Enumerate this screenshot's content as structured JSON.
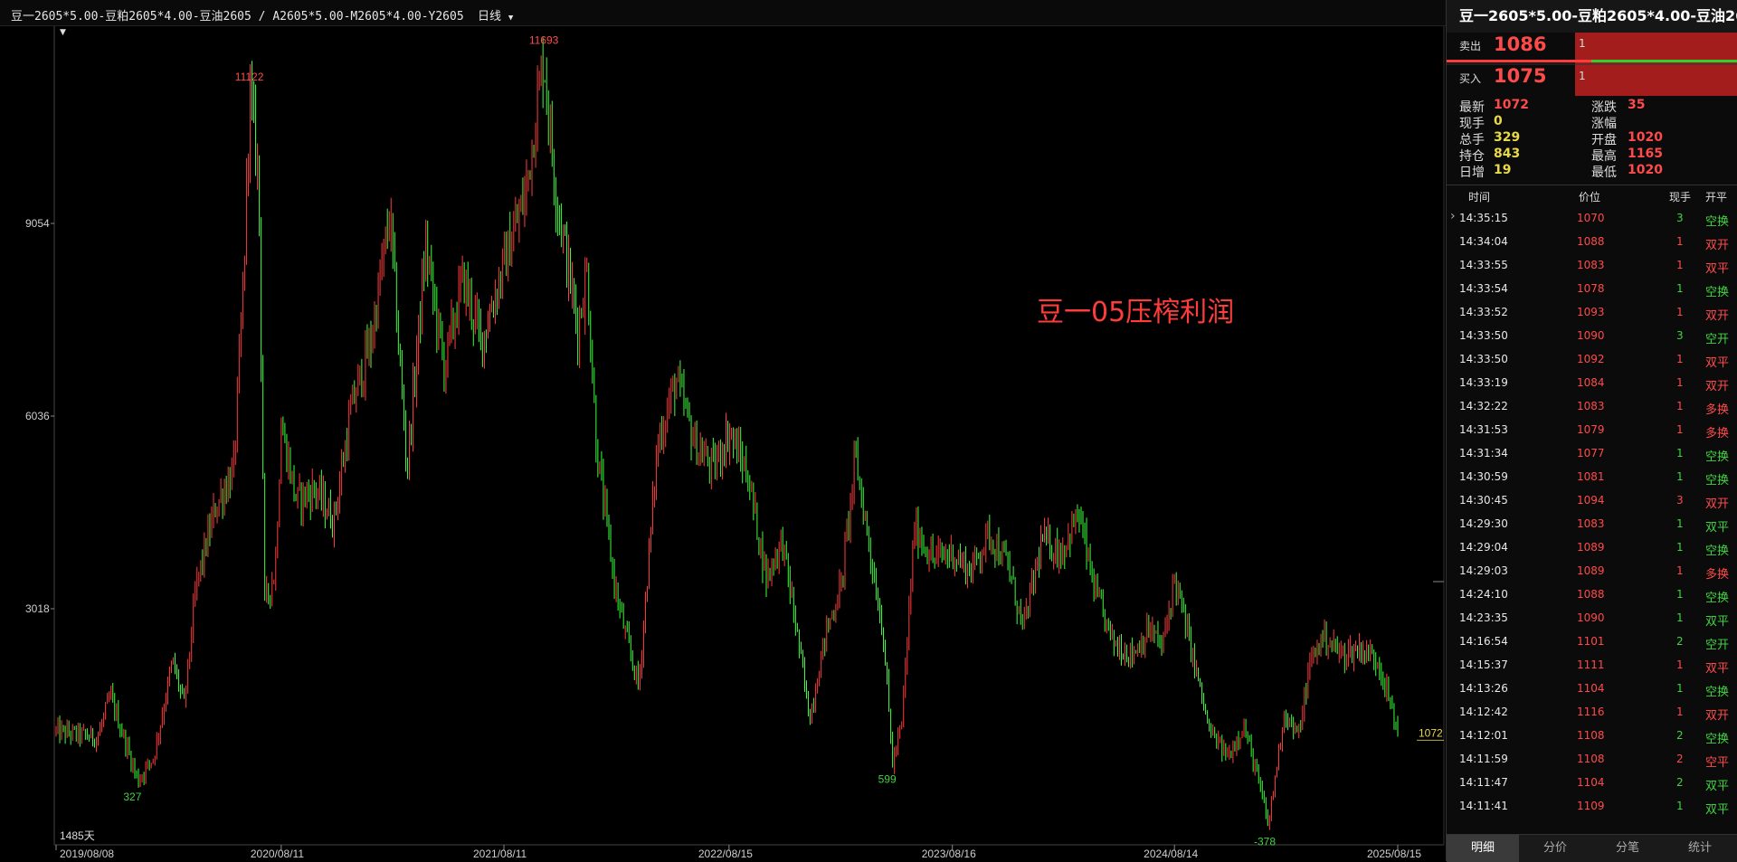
{
  "header": {
    "formula": "豆一2605*5.00-豆粕2605*4.00-豆油2605 / A2605*5.00-M2605*4.00-Y2605",
    "period": "日线"
  },
  "chart_data": {
    "type": "candlestick",
    "title": "豆一05压榨利润",
    "y_ticks": [
      9054,
      6036,
      3018
    ],
    "x_ticks": [
      "2019/08/08",
      "2020/08/11",
      "2021/08/11",
      "2022/08/15",
      "2023/08/16",
      "2024/08/14",
      "2025/08/15"
    ],
    "days_label": "1485天",
    "last_value": 1072,
    "up_color": "#ff3c3c",
    "down_color": "#3cff3c",
    "annotations": [
      {
        "label": "11122",
        "value": 11122,
        "date": "2020/06/20",
        "kind": "high"
      },
      {
        "label": "11693",
        "value": 11693,
        "date": "2021/10/15",
        "kind": "high"
      },
      {
        "label": "327",
        "value": 327,
        "date": "2019/12/20",
        "kind": "low"
      },
      {
        "label": "599",
        "value": 599,
        "date": "2023/05/10",
        "kind": "low"
      },
      {
        "label": "-378",
        "value": -378,
        "date": "2025/01/15",
        "kind": "low"
      }
    ],
    "trend": [
      [
        "2019/08/08",
        1100
      ],
      [
        "2019/10/15",
        1000
      ],
      [
        "2019/11/05",
        1650
      ],
      [
        "2019/12/20",
        327
      ],
      [
        "2020/01/15",
        700
      ],
      [
        "2020/02/15",
        2200
      ],
      [
        "2020/03/05",
        1500
      ],
      [
        "2020/03/25",
        3400
      ],
      [
        "2020/04/25",
        4600
      ],
      [
        "2020/05/25",
        5200
      ],
      [
        "2020/06/10",
        8100
      ],
      [
        "2020/06/20",
        11122
      ],
      [
        "2020/07/05",
        9800
      ],
      [
        "2020/07/15",
        3100
      ],
      [
        "2020/08/01",
        3600
      ],
      [
        "2020/08/11",
        5900
      ],
      [
        "2020/09/05",
        4700
      ],
      [
        "2020/10/05",
        4900
      ],
      [
        "2020/11/05",
        4400
      ],
      [
        "2020/12/05",
        6200
      ],
      [
        "2021/01/05",
        7200
      ],
      [
        "2021/02/05",
        9200
      ],
      [
        "2021/03/05",
        5200
      ],
      [
        "2021/04/05",
        8700
      ],
      [
        "2021/05/05",
        6800
      ],
      [
        "2021/06/05",
        8200
      ],
      [
        "2021/07/05",
        7200
      ],
      [
        "2021/08/11",
        8400
      ],
      [
        "2021/09/15",
        9500
      ],
      [
        "2021/10/15",
        11693
      ],
      [
        "2021/11/01",
        9800
      ],
      [
        "2021/11/20",
        8600
      ],
      [
        "2021/12/10",
        7400
      ],
      [
        "2021/12/25",
        8300
      ],
      [
        "2022/01/10",
        5500
      ],
      [
        "2022/02/10",
        3300
      ],
      [
        "2022/03/01",
        2500
      ],
      [
        "2022/03/20",
        1800
      ],
      [
        "2022/04/20",
        5600
      ],
      [
        "2022/05/20",
        6600
      ],
      [
        "2022/06/20",
        5600
      ],
      [
        "2022/07/20",
        5200
      ],
      [
        "2022/08/15",
        5800
      ],
      [
        "2022/09/15",
        5100
      ],
      [
        "2022/10/15",
        3500
      ],
      [
        "2022/11/10",
        4100
      ],
      [
        "2022/12/05",
        2600
      ],
      [
        "2022/12/25",
        1300
      ],
      [
        "2023/01/20",
        2600
      ],
      [
        "2023/02/15",
        3400
      ],
      [
        "2023/03/10",
        5400
      ],
      [
        "2023/04/05",
        3800
      ],
      [
        "2023/04/25",
        2600
      ],
      [
        "2023/05/10",
        599
      ],
      [
        "2023/05/25",
        1200
      ],
      [
        "2023/06/15",
        4300
      ],
      [
        "2023/07/15",
        3800
      ],
      [
        "2023/08/16",
        3900
      ],
      [
        "2023/09/15",
        3600
      ],
      [
        "2023/10/15",
        4200
      ],
      [
        "2023/11/15",
        3700
      ],
      [
        "2023/12/10",
        2700
      ],
      [
        "2024/01/10",
        4100
      ],
      [
        "2024/02/10",
        3900
      ],
      [
        "2024/03/10",
        4500
      ],
      [
        "2024/04/05",
        3300
      ],
      [
        "2024/05/05",
        2500
      ],
      [
        "2024/06/05",
        2300
      ],
      [
        "2024/07/05",
        2700
      ],
      [
        "2024/07/25",
        2400
      ],
      [
        "2024/08/14",
        3500
      ],
      [
        "2024/09/10",
        2400
      ],
      [
        "2024/10/10",
        1100
      ],
      [
        "2024/11/10",
        700
      ],
      [
        "2024/12/05",
        1200
      ],
      [
        "2024/12/25",
        500
      ],
      [
        "2025/01/15",
        -378
      ],
      [
        "2025/02/10",
        1400
      ],
      [
        "2025/03/05",
        1000
      ],
      [
        "2025/03/25",
        2200
      ],
      [
        "2025/04/15",
        2600
      ],
      [
        "2025/05/15",
        2300
      ],
      [
        "2025/06/15",
        2400
      ],
      [
        "2025/07/15",
        2200
      ],
      [
        "2025/08/15",
        1072
      ]
    ]
  },
  "panel": {
    "title": "豆一2605*5.00-豆粕2605*4.00-豆油2605",
    "sell_label": "卖出",
    "sell_price": "1086",
    "sell_vol": "1",
    "buy_label": "买入",
    "buy_price": "1075",
    "buy_vol": "1",
    "stats": {
      "latest_label": "最新",
      "latest": "1072",
      "change_label": "涨跌",
      "change": "35",
      "cur_label": "现手",
      "cur": "0",
      "pct_label": "涨幅",
      "pct": "",
      "total_label": "总手",
      "total": "329",
      "open_label": "开盘",
      "open": "1020",
      "pos_label": "持仓",
      "pos": "843",
      "high_label": "最高",
      "high": "1165",
      "daily_label": "日增",
      "daily": "19",
      "low_label": "最低",
      "low": "1020"
    },
    "tick_headers": {
      "time": "时间",
      "price": "价位",
      "vol": "现手",
      "type": "开平"
    },
    "ticks": [
      {
        "time": "14:35:15",
        "price": "1070",
        "vol": "3",
        "type": "空换",
        "vc": "green",
        "tc": "green"
      },
      {
        "time": "14:34:04",
        "price": "1088",
        "vol": "1",
        "type": "双开",
        "vc": "red",
        "tc": "red"
      },
      {
        "time": "14:33:55",
        "price": "1083",
        "vol": "1",
        "type": "双平",
        "vc": "red",
        "tc": "red"
      },
      {
        "time": "14:33:54",
        "price": "1078",
        "vol": "1",
        "type": "空换",
        "vc": "green",
        "tc": "green"
      },
      {
        "time": "14:33:52",
        "price": "1093",
        "vol": "1",
        "type": "双开",
        "vc": "red",
        "tc": "red"
      },
      {
        "time": "14:33:50",
        "price": "1090",
        "vol": "3",
        "type": "空开",
        "vc": "green",
        "tc": "green"
      },
      {
        "time": "14:33:50",
        "price": "1092",
        "vol": "1",
        "type": "双平",
        "vc": "red",
        "tc": "red"
      },
      {
        "time": "14:33:19",
        "price": "1084",
        "vol": "1",
        "type": "双开",
        "vc": "red",
        "tc": "red"
      },
      {
        "time": "14:32:22",
        "price": "1083",
        "vol": "1",
        "type": "多换",
        "vc": "red",
        "tc": "red"
      },
      {
        "time": "14:31:53",
        "price": "1079",
        "vol": "1",
        "type": "多换",
        "vc": "red",
        "tc": "red"
      },
      {
        "time": "14:31:34",
        "price": "1077",
        "vol": "1",
        "type": "空换",
        "vc": "green",
        "tc": "green"
      },
      {
        "time": "14:30:59",
        "price": "1081",
        "vol": "1",
        "type": "空换",
        "vc": "green",
        "tc": "green"
      },
      {
        "time": "14:30:45",
        "price": "1094",
        "vol": "3",
        "type": "双开",
        "vc": "red",
        "tc": "red"
      },
      {
        "time": "14:29:30",
        "price": "1083",
        "vol": "1",
        "type": "双平",
        "vc": "green",
        "tc": "green"
      },
      {
        "time": "14:29:04",
        "price": "1089",
        "vol": "1",
        "type": "空换",
        "vc": "green",
        "tc": "green"
      },
      {
        "time": "14:29:03",
        "price": "1089",
        "vol": "1",
        "type": "多换",
        "vc": "red",
        "tc": "red"
      },
      {
        "time": "14:24:10",
        "price": "1088",
        "vol": "1",
        "type": "空换",
        "vc": "green",
        "tc": "green"
      },
      {
        "time": "14:23:35",
        "price": "1090",
        "vol": "1",
        "type": "双平",
        "vc": "green",
        "tc": "green"
      },
      {
        "time": "14:16:54",
        "price": "1101",
        "vol": "2",
        "type": "空开",
        "vc": "green",
        "tc": "green"
      },
      {
        "time": "14:15:37",
        "price": "1111",
        "vol": "1",
        "type": "双平",
        "vc": "red",
        "tc": "red"
      },
      {
        "time": "14:13:26",
        "price": "1104",
        "vol": "1",
        "type": "空换",
        "vc": "green",
        "tc": "green"
      },
      {
        "time": "14:12:42",
        "price": "1116",
        "vol": "1",
        "type": "双开",
        "vc": "red",
        "tc": "red"
      },
      {
        "time": "14:12:01",
        "price": "1108",
        "vol": "2",
        "type": "空换",
        "vc": "green",
        "tc": "green"
      },
      {
        "time": "14:11:59",
        "price": "1108",
        "vol": "2",
        "type": "空平",
        "vc": "red",
        "tc": "red"
      },
      {
        "time": "14:11:47",
        "price": "1104",
        "vol": "2",
        "type": "双平",
        "vc": "green",
        "tc": "green"
      },
      {
        "time": "14:11:41",
        "price": "1109",
        "vol": "1",
        "type": "双平",
        "vc": "green",
        "tc": "green"
      }
    ],
    "tabs": [
      "明细",
      "分价",
      "分笔",
      "统计"
    ]
  }
}
